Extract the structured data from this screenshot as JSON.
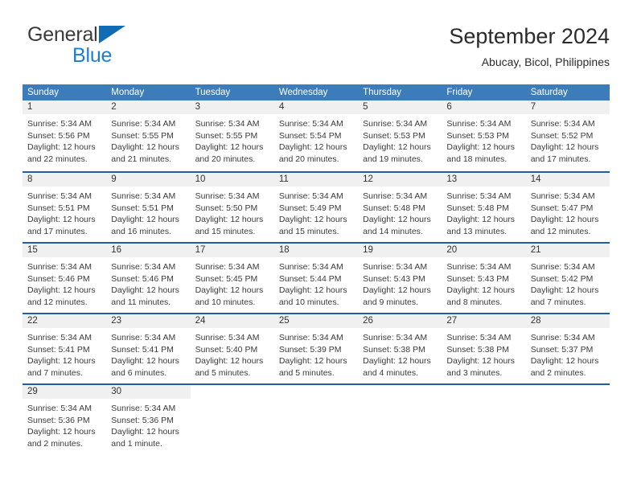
{
  "brand": {
    "name_part1": "General",
    "name_part2": "Blue",
    "logo_icon": "triangle-logo-icon"
  },
  "header": {
    "title": "September 2024",
    "subtitle": "Abucay, Bicol, Philippines"
  },
  "colors": {
    "header_blue": "#3c7cba",
    "separator_blue": "#1f5fa0",
    "daynum_band": "#f0f0f0",
    "brand_blue": "#1a7fd4"
  },
  "weekdays": [
    "Sunday",
    "Monday",
    "Tuesday",
    "Wednesday",
    "Thursday",
    "Friday",
    "Saturday"
  ],
  "labels": {
    "sunrise_prefix": "Sunrise:",
    "sunset_prefix": "Sunset:",
    "daylight_prefix": "Daylight:"
  },
  "weeks": [
    [
      {
        "day": "1",
        "sunrise": "Sunrise: 5:34 AM",
        "sunset": "Sunset: 5:56 PM",
        "daylight_l1": "Daylight: 12 hours",
        "daylight_l2": "and 22 minutes."
      },
      {
        "day": "2",
        "sunrise": "Sunrise: 5:34 AM",
        "sunset": "Sunset: 5:55 PM",
        "daylight_l1": "Daylight: 12 hours",
        "daylight_l2": "and 21 minutes."
      },
      {
        "day": "3",
        "sunrise": "Sunrise: 5:34 AM",
        "sunset": "Sunset: 5:55 PM",
        "daylight_l1": "Daylight: 12 hours",
        "daylight_l2": "and 20 minutes."
      },
      {
        "day": "4",
        "sunrise": "Sunrise: 5:34 AM",
        "sunset": "Sunset: 5:54 PM",
        "daylight_l1": "Daylight: 12 hours",
        "daylight_l2": "and 20 minutes."
      },
      {
        "day": "5",
        "sunrise": "Sunrise: 5:34 AM",
        "sunset": "Sunset: 5:53 PM",
        "daylight_l1": "Daylight: 12 hours",
        "daylight_l2": "and 19 minutes."
      },
      {
        "day": "6",
        "sunrise": "Sunrise: 5:34 AM",
        "sunset": "Sunset: 5:53 PM",
        "daylight_l1": "Daylight: 12 hours",
        "daylight_l2": "and 18 minutes."
      },
      {
        "day": "7",
        "sunrise": "Sunrise: 5:34 AM",
        "sunset": "Sunset: 5:52 PM",
        "daylight_l1": "Daylight: 12 hours",
        "daylight_l2": "and 17 minutes."
      }
    ],
    [
      {
        "day": "8",
        "sunrise": "Sunrise: 5:34 AM",
        "sunset": "Sunset: 5:51 PM",
        "daylight_l1": "Daylight: 12 hours",
        "daylight_l2": "and 17 minutes."
      },
      {
        "day": "9",
        "sunrise": "Sunrise: 5:34 AM",
        "sunset": "Sunset: 5:51 PM",
        "daylight_l1": "Daylight: 12 hours",
        "daylight_l2": "and 16 minutes."
      },
      {
        "day": "10",
        "sunrise": "Sunrise: 5:34 AM",
        "sunset": "Sunset: 5:50 PM",
        "daylight_l1": "Daylight: 12 hours",
        "daylight_l2": "and 15 minutes."
      },
      {
        "day": "11",
        "sunrise": "Sunrise: 5:34 AM",
        "sunset": "Sunset: 5:49 PM",
        "daylight_l1": "Daylight: 12 hours",
        "daylight_l2": "and 15 minutes."
      },
      {
        "day": "12",
        "sunrise": "Sunrise: 5:34 AM",
        "sunset": "Sunset: 5:48 PM",
        "daylight_l1": "Daylight: 12 hours",
        "daylight_l2": "and 14 minutes."
      },
      {
        "day": "13",
        "sunrise": "Sunrise: 5:34 AM",
        "sunset": "Sunset: 5:48 PM",
        "daylight_l1": "Daylight: 12 hours",
        "daylight_l2": "and 13 minutes."
      },
      {
        "day": "14",
        "sunrise": "Sunrise: 5:34 AM",
        "sunset": "Sunset: 5:47 PM",
        "daylight_l1": "Daylight: 12 hours",
        "daylight_l2": "and 12 minutes."
      }
    ],
    [
      {
        "day": "15",
        "sunrise": "Sunrise: 5:34 AM",
        "sunset": "Sunset: 5:46 PM",
        "daylight_l1": "Daylight: 12 hours",
        "daylight_l2": "and 12 minutes."
      },
      {
        "day": "16",
        "sunrise": "Sunrise: 5:34 AM",
        "sunset": "Sunset: 5:46 PM",
        "daylight_l1": "Daylight: 12 hours",
        "daylight_l2": "and 11 minutes."
      },
      {
        "day": "17",
        "sunrise": "Sunrise: 5:34 AM",
        "sunset": "Sunset: 5:45 PM",
        "daylight_l1": "Daylight: 12 hours",
        "daylight_l2": "and 10 minutes."
      },
      {
        "day": "18",
        "sunrise": "Sunrise: 5:34 AM",
        "sunset": "Sunset: 5:44 PM",
        "daylight_l1": "Daylight: 12 hours",
        "daylight_l2": "and 10 minutes."
      },
      {
        "day": "19",
        "sunrise": "Sunrise: 5:34 AM",
        "sunset": "Sunset: 5:43 PM",
        "daylight_l1": "Daylight: 12 hours",
        "daylight_l2": "and 9 minutes."
      },
      {
        "day": "20",
        "sunrise": "Sunrise: 5:34 AM",
        "sunset": "Sunset: 5:43 PM",
        "daylight_l1": "Daylight: 12 hours",
        "daylight_l2": "and 8 minutes."
      },
      {
        "day": "21",
        "sunrise": "Sunrise: 5:34 AM",
        "sunset": "Sunset: 5:42 PM",
        "daylight_l1": "Daylight: 12 hours",
        "daylight_l2": "and 7 minutes."
      }
    ],
    [
      {
        "day": "22",
        "sunrise": "Sunrise: 5:34 AM",
        "sunset": "Sunset: 5:41 PM",
        "daylight_l1": "Daylight: 12 hours",
        "daylight_l2": "and 7 minutes."
      },
      {
        "day": "23",
        "sunrise": "Sunrise: 5:34 AM",
        "sunset": "Sunset: 5:41 PM",
        "daylight_l1": "Daylight: 12 hours",
        "daylight_l2": "and 6 minutes."
      },
      {
        "day": "24",
        "sunrise": "Sunrise: 5:34 AM",
        "sunset": "Sunset: 5:40 PM",
        "daylight_l1": "Daylight: 12 hours",
        "daylight_l2": "and 5 minutes."
      },
      {
        "day": "25",
        "sunrise": "Sunrise: 5:34 AM",
        "sunset": "Sunset: 5:39 PM",
        "daylight_l1": "Daylight: 12 hours",
        "daylight_l2": "and 5 minutes."
      },
      {
        "day": "26",
        "sunrise": "Sunrise: 5:34 AM",
        "sunset": "Sunset: 5:38 PM",
        "daylight_l1": "Daylight: 12 hours",
        "daylight_l2": "and 4 minutes."
      },
      {
        "day": "27",
        "sunrise": "Sunrise: 5:34 AM",
        "sunset": "Sunset: 5:38 PM",
        "daylight_l1": "Daylight: 12 hours",
        "daylight_l2": "and 3 minutes."
      },
      {
        "day": "28",
        "sunrise": "Sunrise: 5:34 AM",
        "sunset": "Sunset: 5:37 PM",
        "daylight_l1": "Daylight: 12 hours",
        "daylight_l2": "and 2 minutes."
      }
    ],
    [
      {
        "day": "29",
        "sunrise": "Sunrise: 5:34 AM",
        "sunset": "Sunset: 5:36 PM",
        "daylight_l1": "Daylight: 12 hours",
        "daylight_l2": "and 2 minutes."
      },
      {
        "day": "30",
        "sunrise": "Sunrise: 5:34 AM",
        "sunset": "Sunset: 5:36 PM",
        "daylight_l1": "Daylight: 12 hours",
        "daylight_l2": "and 1 minute."
      },
      {
        "day": "",
        "sunrise": "",
        "sunset": "",
        "daylight_l1": "",
        "daylight_l2": ""
      },
      {
        "day": "",
        "sunrise": "",
        "sunset": "",
        "daylight_l1": "",
        "daylight_l2": ""
      },
      {
        "day": "",
        "sunrise": "",
        "sunset": "",
        "daylight_l1": "",
        "daylight_l2": ""
      },
      {
        "day": "",
        "sunrise": "",
        "sunset": "",
        "daylight_l1": "",
        "daylight_l2": ""
      },
      {
        "day": "",
        "sunrise": "",
        "sunset": "",
        "daylight_l1": "",
        "daylight_l2": ""
      }
    ]
  ]
}
